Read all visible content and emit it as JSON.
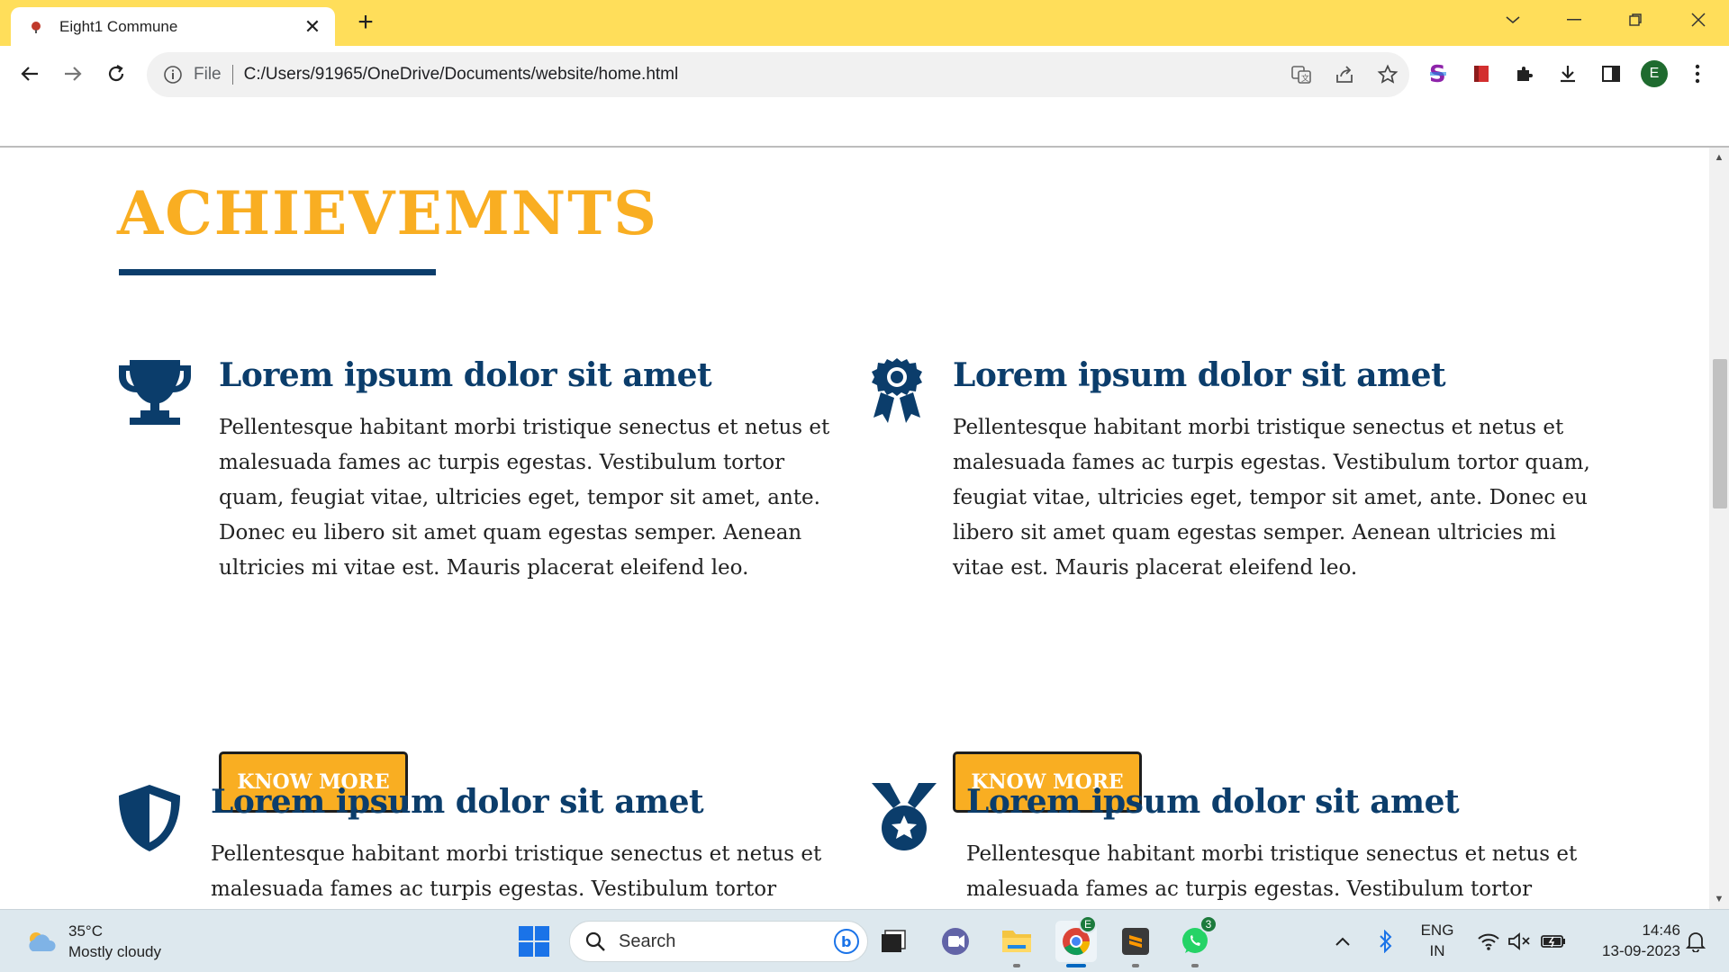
{
  "browser": {
    "tab_title": "Eight1 Commune",
    "new_tab_symbol": "+",
    "close_symbol": "✕",
    "scheme_label": "File",
    "url": "C:/Users/91965/OneDrive/Documents/website/home.html",
    "profile_initial": "E"
  },
  "page": {
    "section_title": "ACHIEVEMNTS",
    "cards": [
      {
        "icon": "trophy-icon",
        "heading": "Lorem ipsum dolor sit amet",
        "body": "Pellentesque habitant morbi tristique senectus et netus et malesuada fames ac turpis egestas. Vestibulum tortor quam, feugiat vitae, ultricies eget, tempor sit amet, ante. Donec eu libero sit amet quam egestas semper. Aenean ultricies mi vitae est. Mauris placerat eleifend leo.",
        "button": "KNOW MORE"
      },
      {
        "icon": "award-ribbon-icon",
        "heading": "Lorem ipsum dolor sit amet",
        "body": "Pellentesque habitant morbi tristique senectus et netus et malesuada fames ac turpis egestas. Vestibulum tortor quam, feugiat vitae, ultricies eget, tempor sit amet, ante. Donec eu libero sit amet quam egestas semper. Aenean ultricies mi vitae est. Mauris placerat eleifend leo.",
        "button": "KNOW MORE"
      },
      {
        "icon": "shield-icon",
        "heading": "Lorem ipsum dolor sit amet",
        "body": "Pellentesque habitant morbi tristique senectus et netus et malesuada fames ac turpis egestas. Vestibulum tortor quam,"
      },
      {
        "icon": "medal-icon",
        "heading": "Lorem ipsum dolor sit amet",
        "body": "Pellentesque habitant morbi tristique senectus et netus et malesuada fames ac turpis egestas. Vestibulum tortor quam,"
      }
    ]
  },
  "taskbar": {
    "weather_temp": "35°C",
    "weather_desc": "Mostly cloudy",
    "search_placeholder": "Search",
    "chrome_badge": "E",
    "whatsapp_badge": "3",
    "lang_line1": "ENG",
    "lang_line2": "IN",
    "time": "14:46",
    "date": "13-09-2023"
  },
  "colors": {
    "tabbar": "#ffde5a",
    "accent_gold": "#f9ae22",
    "navy": "#0b3d6b"
  }
}
